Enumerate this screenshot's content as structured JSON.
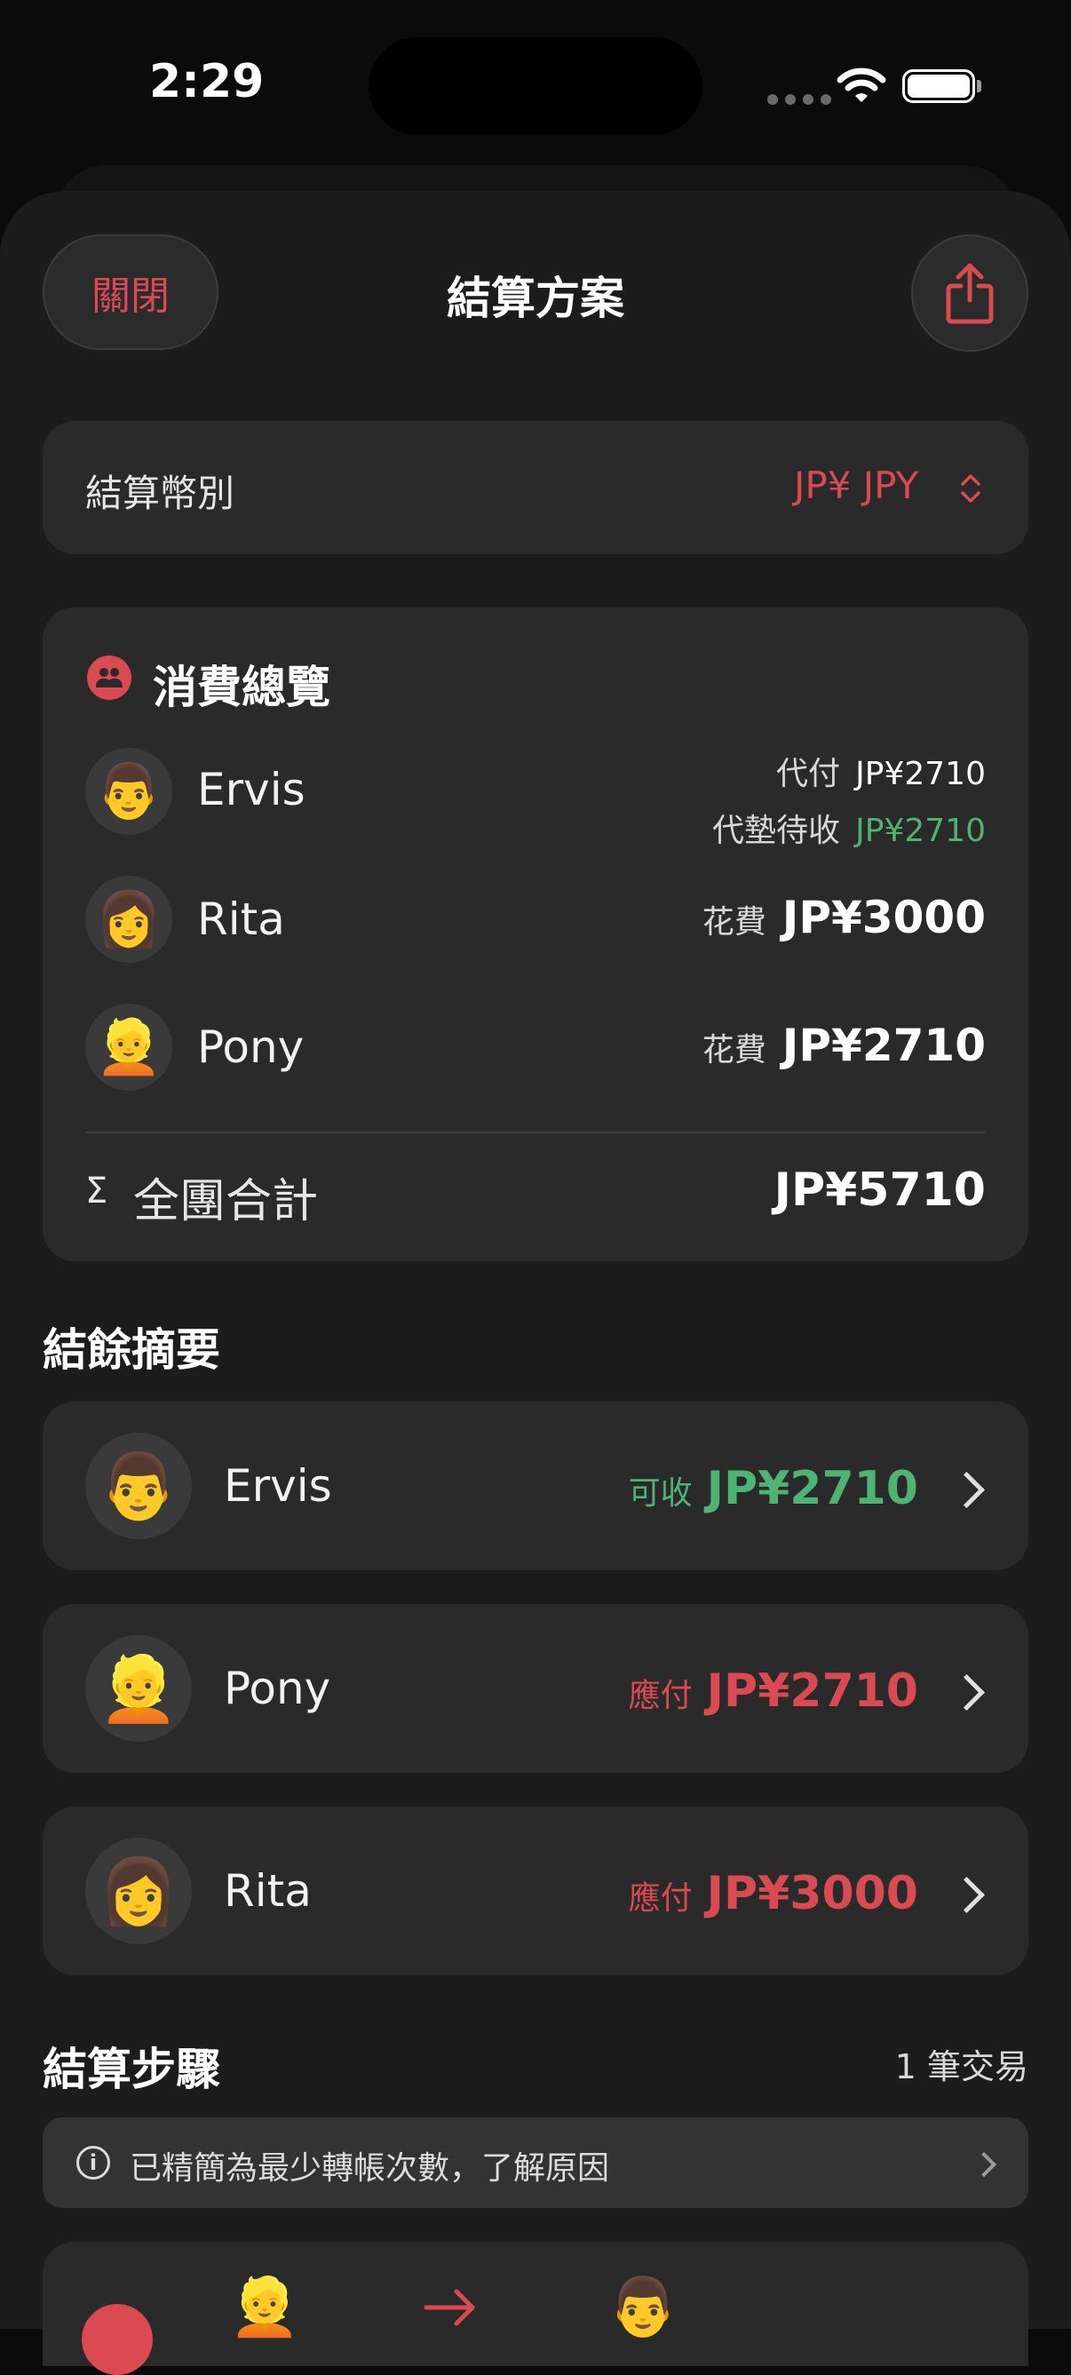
{
  "status_bar": {
    "time": "2:29"
  },
  "header": {
    "close_label": "關閉",
    "title": "結算方案"
  },
  "currency": {
    "label": "結算幣別",
    "value": "JP¥ JPY"
  },
  "overview": {
    "title": "消費總覽",
    "people": [
      {
        "avatar": "👨",
        "name": "Ervis",
        "line1_label": "代付",
        "line1_amount": "JP¥2710",
        "line2_label": "代墊待收",
        "line2_amount": "JP¥2710"
      },
      {
        "avatar": "👩",
        "name": "Rita",
        "label": "花費",
        "amount": "JP¥3000"
      },
      {
        "avatar": "👱",
        "name": "Pony",
        "label": "花費",
        "amount": "JP¥2710"
      }
    ],
    "total_symbol": "Σ",
    "total_label": "全團合計",
    "total_amount": "JP¥5710"
  },
  "balances": {
    "title": "結餘摘要",
    "items": [
      {
        "avatar": "👨",
        "name": "Ervis",
        "label": "可收",
        "amount": "JP¥2710",
        "type": "receive"
      },
      {
        "avatar": "👱",
        "name": "Pony",
        "label": "應付",
        "amount": "JP¥2710",
        "type": "pay"
      },
      {
        "avatar": "👩",
        "name": "Rita",
        "label": "應付",
        "amount": "JP¥3000",
        "type": "pay"
      }
    ]
  },
  "steps": {
    "title": "結算步驟",
    "count": "1 筆交易",
    "info": "已精簡為最少轉帳次數，了解原因",
    "from_avatar": "👱",
    "to_avatar": "👨"
  },
  "colors": {
    "accent": "#d94a52",
    "positive": "#4fb373",
    "card": "#2a2a2a",
    "sheet": "#1c1c1c"
  }
}
